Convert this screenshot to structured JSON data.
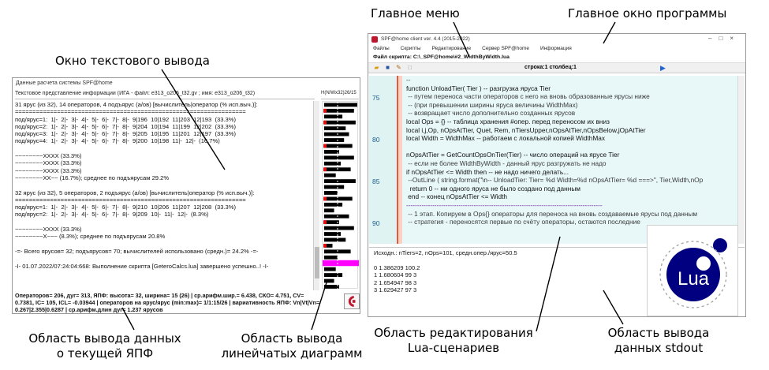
{
  "annotations": {
    "main_menu": "Главное меню",
    "main_window": "Главное окно программы",
    "text_output_window": "Окно текстового вывода",
    "current_data_area_line1": "Область вывода данных",
    "current_data_area_line2": "о текущей ЯПФ",
    "bar_area_line1": "Область вывода",
    "bar_area_line2": "линейчатых диаграмм",
    "editor_area_line1": "Область редактирования",
    "editor_area_line2": "Lua-сценариев",
    "stdout_area_line1": "Область вывода",
    "stdout_area_line2": "данных stdout"
  },
  "left_window": {
    "title": "Данные расчета системы SPF@home",
    "subtitle": "Текстовое представление информации (ИГА - файл: e313_o206_t32.gv ; имя: e313_o206_t32)",
    "bar_header": "Н(N/Wx32)26/15",
    "text_lines": [
      "31 ярус (из 32), 14 операторов, 4 подъярус (а/ов) [вычислитель|оператор (% исп.выч.)]:",
      "==================================================================",
      "под/ярус=1:  1|-  2|-  3|-  4|-  5|-  6|-  7|-  8|-  9|196  10|192  11|203  12|193  (33.3%)",
      "под/ярус=2:  1|-  2|-  3|-  4|-  5|-  6|-  7|-  8|-  9|204  10|194  11|199  12|202  (33.3%)",
      "под/ярус=3:  1|-  2|-  3|-  4|-  5|-  6|-  7|-  8|-  9|205  10|195  11|201  12|197  (33.3%)",
      "под/ярус=4:  1|-  2|-  3|-  4|-  5|-  6|-  7|-  8|-  9|200  10|198  11|-  12|-  (16.7%)",
      "",
      "~~~~~~~~XXXX (33.3%)",
      "~~~~~~~~XXXX (33.3%)",
      "~~~~~~~~XXXX (33.3%)",
      "~~~~~~~~XX~~ (16.7%); среднее по подъярусам 29.2%",
      "",
      "32 ярус (из 32), 5 операторов, 2 подъярус (а/ов) [вычислитель|оператор (% исп.выч.)]:",
      "==================================================================",
      "под/ярус=1:  1|-  2|-  3|-  4|-  5|-  6|-  7|-  8|-  9|210  10|206  11|207  12|208  (33.3%)",
      "под/ярус=2:  1|-  2|-  3|-  4|-  5|-  6|-  7|-  8|-  9|209  10|-  11|-  12|-  (8.3%)",
      "",
      "~~~~~~~~XXXX (33.3%)",
      "~~~~~~~~X~~~ (8.3%); среднее по подъярусам 20.8%",
      "",
      "-=- Всего ярусов= 32; подъярусов= 70; вычислителей использовано (средн.)= 24.2% -=-",
      "",
      "-I- 01.07.2022/07:24:04:668: Выполнение скрипта [GeteroCalcs.lua] завершено успешно..! -I-"
    ],
    "status_lines": [
      "Операторов= 206, дуг= 313, ЯПФ: высота= 32, ширина= 15 (26) | ср.арифм.шир.= 6.438, СКО= 4.751, CV=",
      "0.7381, IC= 105, ICL= -0.03944 | операторов на ярус/ярус (min:max)= 1/1:15/26 | вариативность ЯПФ: Vn|Vt|Vn=",
      "0.267|2.355|0.6287 | ср.арифм.длин дуг= 1.237 ярусов"
    ]
  },
  "bar_chart": {
    "values": [
      1.0,
      0.9,
      0.55,
      0.95,
      0.65,
      0.75,
      0.6,
      0.85,
      0.45,
      0.9,
      0.5,
      0.8,
      0.35,
      0.95,
      0.6,
      0.4,
      0.85,
      0.55,
      0.3,
      0.75,
      0.45,
      0.9,
      0.5,
      0.65,
      0.25,
      0.8,
      0.4,
      0.7,
      0.35,
      0.55,
      0.3,
      0.45
    ],
    "red_rows": [
      1,
      3,
      7,
      11,
      16,
      20,
      24
    ],
    "highlight_row": 27,
    "colors": {
      "bar": "#000000",
      "red": "#dd1010",
      "highlight": "#ff00ff"
    }
  },
  "right_window": {
    "title": "SPF@home client ver. 4.4 (2015-2022)",
    "menu": [
      "Файлы",
      "Скрипты",
      "Редактирование",
      "Сервер SPF@home",
      "Информация"
    ],
    "script_label": "Файл скрипта: C:\\_SPF@home\\#2_WidthByWidth.lua",
    "cursor_pos": "строка:1 столбец:1",
    "line_numbers": [
      "75",
      "80",
      "85",
      "90"
    ],
    "code_lines": [
      {
        "t": "--",
        "c": "cm"
      },
      {
        "t": "function UnloadTier( Tier ) -- разгрузка яруса Tier",
        "c": "fn"
      },
      {
        "t": " -- путем переноса части операторов с него на вновь образованные ярусы ниже",
        "c": "cm"
      },
      {
        "t": " -- (при превышении ширины яруса величины WidthMax)",
        "c": "cm"
      },
      {
        "t": " -- возвращает число дополнительно созданных ярусов",
        "c": "cm"
      },
      {
        "t": "local Ops = {} -- таблица хранения #опер. перед переносом их вниз",
        "c": "loc"
      },
      {
        "t": "local i,j,Op, nOpsAtTier, Quet, Rem, nTiersUpper,nOpsAtTier,nOpsBelow,jOpAtTier",
        "c": "loc"
      },
      {
        "t": "local Width = WidthMax -- работаем с локальной копией WidthMax",
        "c": "loc"
      },
      {
        "t": "",
        "c": ""
      },
      {
        "t": "nOpsAtTier = GetCountOpsOnTier(Tier) -- число операций на ярусе Tier",
        "c": "fn2"
      },
      {
        "t": " -- если не более WidthByWidth - данный ярус разгружать не надо",
        "c": "cm"
      },
      {
        "t": "if nOpsAtTier <= Width then -- не надо ничего делать...",
        "c": "if"
      },
      {
        "t": " --OutLine ( string.format(\"\\n-- UnloadTier: Tier= %d Width=%d nOpsAtTier= %d ===>\", Tier,Width,nOp",
        "c": "cm"
      },
      {
        "t": "  return 0 -- ни одного яруса не было создано под данным",
        "c": "ret"
      },
      {
        "t": " end -- конец nOpsAtTier <= Width",
        "c": "end"
      },
      {
        "t": "------------------------------------------------------------------------------------------",
        "c": "sep"
      },
      {
        "t": " -- 1 этап. Копируем в Ops{} операторы для переноса на вновь создаваемые ярусы под данным",
        "c": "cm"
      },
      {
        "t": " -- стратегия - переносятся первые по счёту операторы, остаются последние",
        "c": "cm"
      }
    ],
    "stdout_lines": [
      "Исходн.: nTiers=2, nOps=101, средн.опер./ярус=50.5",
      "",
      "0 1.386209 100.2",
      "1 1.680604 99 3",
      "2 1.654947 98 3",
      "3 1.629427 97 3"
    ]
  },
  "lua_logo": {
    "text": "Lua",
    "color": "#000080"
  }
}
